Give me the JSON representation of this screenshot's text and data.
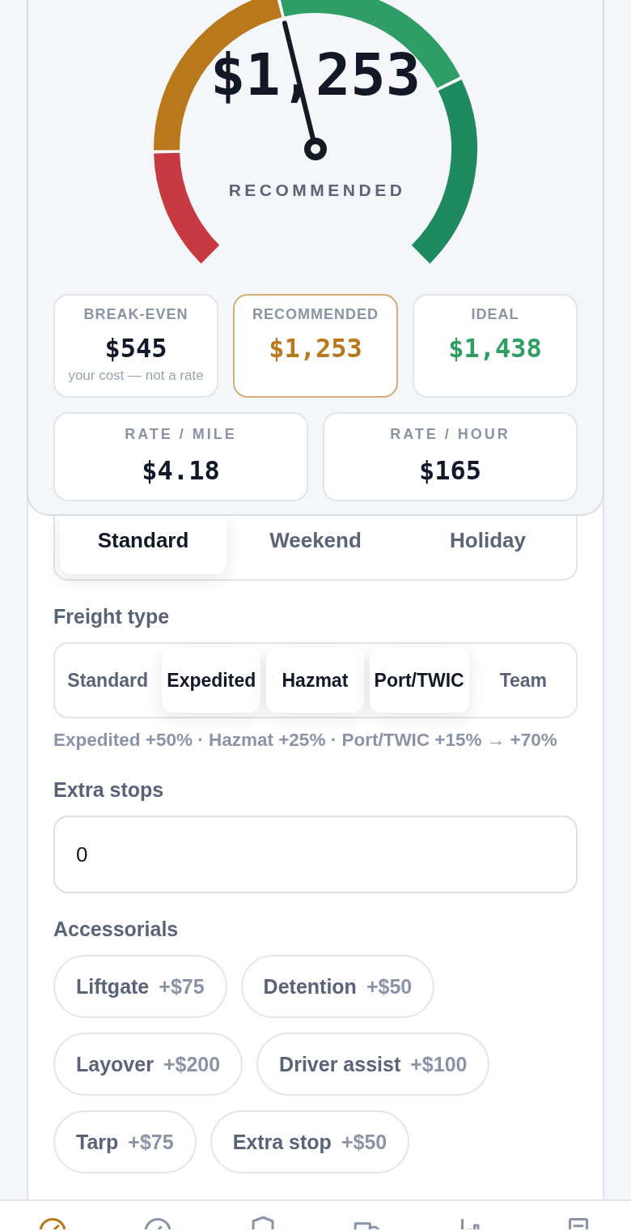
{
  "gauge": {
    "value": "$1,253",
    "label": "RECOMMENDED",
    "level": 0.449
  },
  "stats": [
    {
      "label": "BREAK-EVEN",
      "value": "$545",
      "note": "your cost — not a rate",
      "color": "#111827",
      "highlighted": false
    },
    {
      "label": "RECOMMENDED",
      "value": "$1,253",
      "color": "#b8781b",
      "highlighted": true
    },
    {
      "label": "IDEAL",
      "value": "$1,438",
      "color": "#2e9e62",
      "highlighted": false
    }
  ],
  "rates": [
    {
      "label": "RATE / MILE",
      "value": "$4.18"
    },
    {
      "label": "RATE / HOUR",
      "value": "$165"
    }
  ],
  "rate_day": {
    "options": [
      {
        "label": "Standard",
        "selected": true
      },
      {
        "label": "Weekend",
        "selected": false
      },
      {
        "label": "Holiday",
        "selected": false
      }
    ]
  },
  "freight_type": {
    "label": "Freight type",
    "options": [
      {
        "label": "Standard",
        "selected": false
      },
      {
        "label": "Expedited",
        "selected": true
      },
      {
        "label": "Hazmat",
        "selected": true
      },
      {
        "label": "Port/TWIC",
        "selected": true
      },
      {
        "label": "Team",
        "selected": false
      }
    ],
    "summary": "Expedited +50% · Hazmat +25% · Port/TWIC +15% → +70%"
  },
  "extra_stops": {
    "label": "Extra stops",
    "value": "0"
  },
  "accessorials": {
    "label": "Accessorials",
    "items": [
      {
        "name": "Liftgate",
        "price": "+$75",
        "selected": false
      },
      {
        "name": "Detention",
        "price": "+$50",
        "selected": false
      },
      {
        "name": "Layover",
        "price": "+$200",
        "selected": false
      },
      {
        "name": "Driver assist",
        "price": "+$100",
        "selected": false
      },
      {
        "name": "Tarp",
        "price": "+$75",
        "selected": false
      },
      {
        "name": "Extra stop",
        "price": "+$50",
        "selected": false
      }
    ]
  },
  "nav": {
    "items": [
      {
        "selected": true
      },
      {
        "selected": false
      },
      {
        "selected": false
      },
      {
        "selected": false
      },
      {
        "selected": false
      },
      {
        "selected": false
      }
    ]
  }
}
